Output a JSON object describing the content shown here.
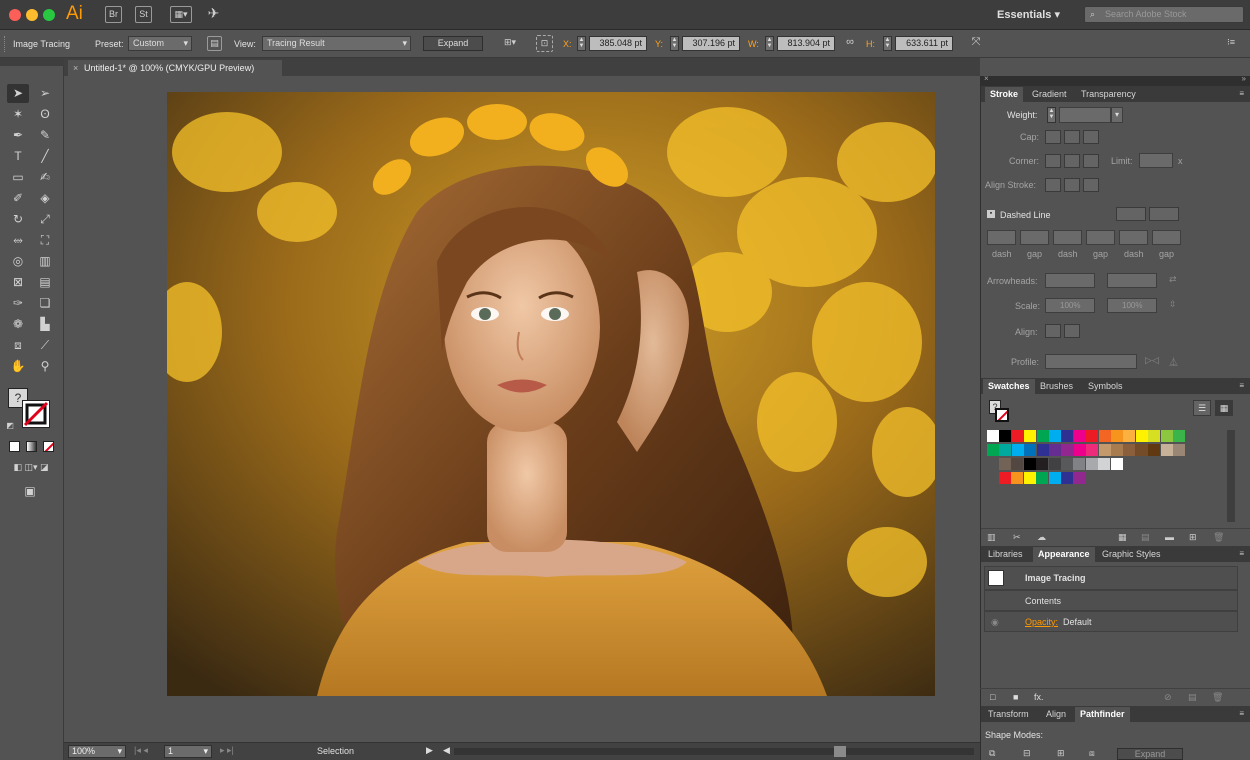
{
  "app": {
    "name": "Ai",
    "workspace": "Essentials",
    "search_placeholder": "Search Adobe Stock"
  },
  "control": {
    "panel_label": "Image Tracing",
    "preset_label": "Preset:",
    "preset_value": "Custom",
    "view_label": "View:",
    "view_value": "Tracing Result",
    "expand_label": "Expand",
    "x_label": "X:",
    "x_value": "385.048 pt",
    "y_label": "Y:",
    "y_value": "307.196 pt",
    "w_label": "W:",
    "w_value": "813.904 pt",
    "h_label": "H:",
    "h_value": "633.611 pt"
  },
  "document": {
    "tab_title": "Untitled-1* @ 100% (CMYK/GPU Preview)"
  },
  "status": {
    "zoom": "100%",
    "artboard": "1",
    "tool": "Selection"
  },
  "stroke_panel": {
    "tabs": [
      "Stroke",
      "Gradient",
      "Transparency"
    ],
    "weight_label": "Weight:",
    "cap_label": "Cap:",
    "corner_label": "Corner:",
    "limit_label": "Limit:",
    "limit_unit": "x",
    "align_label": "Align Stroke:",
    "dashed_label": "Dashed Line",
    "dash_labels": [
      "dash",
      "gap",
      "dash",
      "gap",
      "dash",
      "gap"
    ],
    "arrowheads_label": "Arrowheads:",
    "scale_label": "Scale:",
    "scale_value1": "100%",
    "scale_value2": "100%",
    "align_arrow_label": "Align:",
    "profile_label": "Profile:"
  },
  "swatches_panel": {
    "tabs": [
      "Swatches",
      "Brushes",
      "Symbols"
    ],
    "row1": [
      "#ffffff",
      "#000000",
      "#ed1c24",
      "#fff200",
      "#00a651",
      "#00aeef",
      "#2e3192",
      "#ec008c",
      "#ed1c24",
      "#f26522",
      "#f7941d",
      "#fbb040",
      "#fff200",
      "#d7df23",
      "#8dc63f",
      "#39b54a"
    ],
    "row2": [
      "#00a651",
      "#00a99d",
      "#00aeef",
      "#0072bc",
      "#2e3192",
      "#662d91",
      "#92278f",
      "#ec008c",
      "#ee2a7b",
      "#c49a6c",
      "#a97c50",
      "#8b5e3c",
      "#754c29",
      "#603913",
      "#c7b299",
      "#998675"
    ],
    "row3": [
      "#736357",
      "#534741",
      "#000000",
      "#231f20",
      "#414042",
      "#58595b",
      "#808285",
      "#a7a9ac",
      "#d1d3d4",
      "#ffffff"
    ],
    "row4": [
      "#ed1c24",
      "#f7941d",
      "#fff200",
      "#00a651",
      "#00aeef",
      "#2e3192",
      "#92278f"
    ]
  },
  "appearance_panel": {
    "tabs": [
      "Libraries",
      "Appearance",
      "Graphic Styles"
    ],
    "object": "Image Tracing",
    "contents": "Contents",
    "opacity_label": "Opacity:",
    "opacity_value": "Default"
  },
  "pathfinder_panel": {
    "tabs": [
      "Transform",
      "Align",
      "Pathfinder"
    ],
    "shape_modes_label": "Shape Modes:",
    "expand_label": "Expand"
  },
  "colors": {
    "accent": "#ff9a00",
    "ui_bg": "#535353",
    "panel_dark": "#3a3a3a"
  }
}
